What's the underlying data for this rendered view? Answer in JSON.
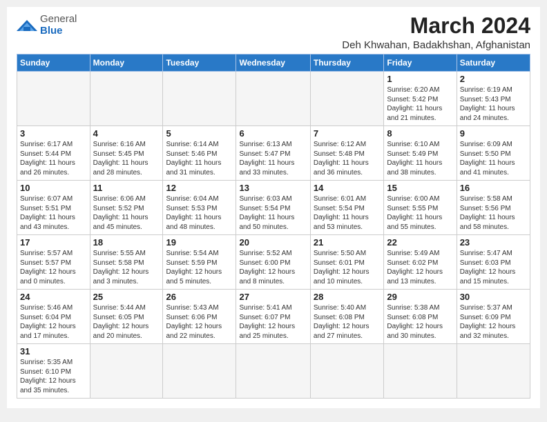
{
  "logo": {
    "general": "General",
    "blue": "Blue"
  },
  "header": {
    "title": "March 2024",
    "subtitle": "Deh Khwahan, Badakhshan, Afghanistan"
  },
  "weekdays": [
    "Sunday",
    "Monday",
    "Tuesday",
    "Wednesday",
    "Thursday",
    "Friday",
    "Saturday"
  ],
  "weeks": [
    [
      {
        "day": null,
        "info": null
      },
      {
        "day": null,
        "info": null
      },
      {
        "day": null,
        "info": null
      },
      {
        "day": null,
        "info": null
      },
      {
        "day": null,
        "info": null
      },
      {
        "day": "1",
        "info": "Sunrise: 6:20 AM\nSunset: 5:42 PM\nDaylight: 11 hours\nand 21 minutes."
      },
      {
        "day": "2",
        "info": "Sunrise: 6:19 AM\nSunset: 5:43 PM\nDaylight: 11 hours\nand 24 minutes."
      }
    ],
    [
      {
        "day": "3",
        "info": "Sunrise: 6:17 AM\nSunset: 5:44 PM\nDaylight: 11 hours\nand 26 minutes."
      },
      {
        "day": "4",
        "info": "Sunrise: 6:16 AM\nSunset: 5:45 PM\nDaylight: 11 hours\nand 28 minutes."
      },
      {
        "day": "5",
        "info": "Sunrise: 6:14 AM\nSunset: 5:46 PM\nDaylight: 11 hours\nand 31 minutes."
      },
      {
        "day": "6",
        "info": "Sunrise: 6:13 AM\nSunset: 5:47 PM\nDaylight: 11 hours\nand 33 minutes."
      },
      {
        "day": "7",
        "info": "Sunrise: 6:12 AM\nSunset: 5:48 PM\nDaylight: 11 hours\nand 36 minutes."
      },
      {
        "day": "8",
        "info": "Sunrise: 6:10 AM\nSunset: 5:49 PM\nDaylight: 11 hours\nand 38 minutes."
      },
      {
        "day": "9",
        "info": "Sunrise: 6:09 AM\nSunset: 5:50 PM\nDaylight: 11 hours\nand 41 minutes."
      }
    ],
    [
      {
        "day": "10",
        "info": "Sunrise: 6:07 AM\nSunset: 5:51 PM\nDaylight: 11 hours\nand 43 minutes."
      },
      {
        "day": "11",
        "info": "Sunrise: 6:06 AM\nSunset: 5:52 PM\nDaylight: 11 hours\nand 45 minutes."
      },
      {
        "day": "12",
        "info": "Sunrise: 6:04 AM\nSunset: 5:53 PM\nDaylight: 11 hours\nand 48 minutes."
      },
      {
        "day": "13",
        "info": "Sunrise: 6:03 AM\nSunset: 5:54 PM\nDaylight: 11 hours\nand 50 minutes."
      },
      {
        "day": "14",
        "info": "Sunrise: 6:01 AM\nSunset: 5:54 PM\nDaylight: 11 hours\nand 53 minutes."
      },
      {
        "day": "15",
        "info": "Sunrise: 6:00 AM\nSunset: 5:55 PM\nDaylight: 11 hours\nand 55 minutes."
      },
      {
        "day": "16",
        "info": "Sunrise: 5:58 AM\nSunset: 5:56 PM\nDaylight: 11 hours\nand 58 minutes."
      }
    ],
    [
      {
        "day": "17",
        "info": "Sunrise: 5:57 AM\nSunset: 5:57 PM\nDaylight: 12 hours\nand 0 minutes."
      },
      {
        "day": "18",
        "info": "Sunrise: 5:55 AM\nSunset: 5:58 PM\nDaylight: 12 hours\nand 3 minutes."
      },
      {
        "day": "19",
        "info": "Sunrise: 5:54 AM\nSunset: 5:59 PM\nDaylight: 12 hours\nand 5 minutes."
      },
      {
        "day": "20",
        "info": "Sunrise: 5:52 AM\nSunset: 6:00 PM\nDaylight: 12 hours\nand 8 minutes."
      },
      {
        "day": "21",
        "info": "Sunrise: 5:50 AM\nSunset: 6:01 PM\nDaylight: 12 hours\nand 10 minutes."
      },
      {
        "day": "22",
        "info": "Sunrise: 5:49 AM\nSunset: 6:02 PM\nDaylight: 12 hours\nand 13 minutes."
      },
      {
        "day": "23",
        "info": "Sunrise: 5:47 AM\nSunset: 6:03 PM\nDaylight: 12 hours\nand 15 minutes."
      }
    ],
    [
      {
        "day": "24",
        "info": "Sunrise: 5:46 AM\nSunset: 6:04 PM\nDaylight: 12 hours\nand 17 minutes."
      },
      {
        "day": "25",
        "info": "Sunrise: 5:44 AM\nSunset: 6:05 PM\nDaylight: 12 hours\nand 20 minutes."
      },
      {
        "day": "26",
        "info": "Sunrise: 5:43 AM\nSunset: 6:06 PM\nDaylight: 12 hours\nand 22 minutes."
      },
      {
        "day": "27",
        "info": "Sunrise: 5:41 AM\nSunset: 6:07 PM\nDaylight: 12 hours\nand 25 minutes."
      },
      {
        "day": "28",
        "info": "Sunrise: 5:40 AM\nSunset: 6:08 PM\nDaylight: 12 hours\nand 27 minutes."
      },
      {
        "day": "29",
        "info": "Sunrise: 5:38 AM\nSunset: 6:08 PM\nDaylight: 12 hours\nand 30 minutes."
      },
      {
        "day": "30",
        "info": "Sunrise: 5:37 AM\nSunset: 6:09 PM\nDaylight: 12 hours\nand 32 minutes."
      }
    ],
    [
      {
        "day": "31",
        "info": "Sunrise: 5:35 AM\nSunset: 6:10 PM\nDaylight: 12 hours\nand 35 minutes."
      },
      {
        "day": null,
        "info": null
      },
      {
        "day": null,
        "info": null
      },
      {
        "day": null,
        "info": null
      },
      {
        "day": null,
        "info": null
      },
      {
        "day": null,
        "info": null
      },
      {
        "day": null,
        "info": null
      }
    ]
  ]
}
